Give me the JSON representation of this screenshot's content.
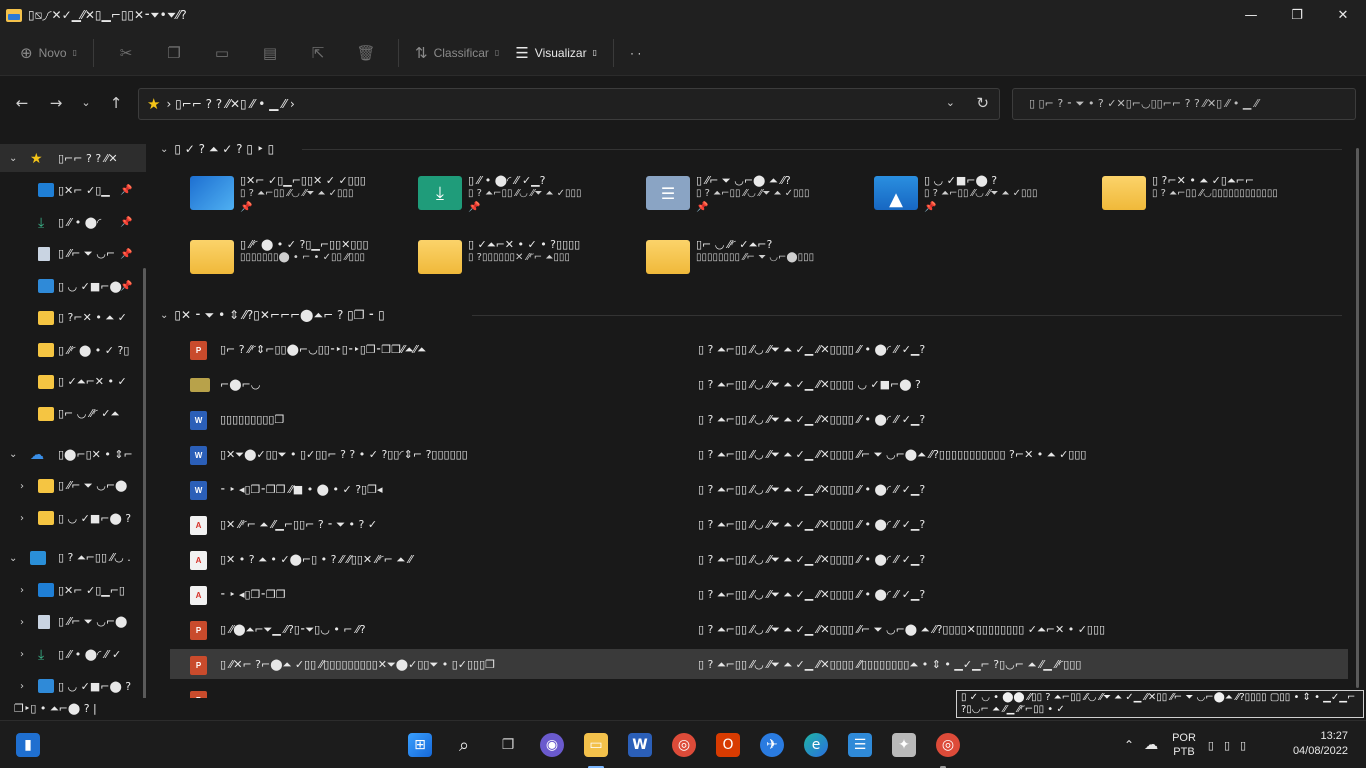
{
  "window": {
    "title": "▯⧅◞◜✕✓▁⁄⁄✕▯▁⌐▯▯✕⁃⏷•⏷⁄⁄?",
    "minimize_glyph": "—",
    "maximize_glyph": "❐",
    "close_glyph": "✕"
  },
  "commandbar": {
    "new_label": "Novo",
    "sort_label": "Classificar",
    "view_label": "Visualizar",
    "more_glyph": "· ·"
  },
  "address": {
    "breadcrumb": "› ▯⌐⌐ ? ? ⁄⁄✕▯ ⁄⁄ • ▁ ⁄⁄ ›",
    "search_placeholder": "▯     ▯⌐ ? ⁃ ⏷ • ? ✓✕▯⌐◡▯▯⌐⌐ ? ? ⁄⁄✕▯ ⁄⁄ • ▁ ⁄⁄"
  },
  "sidebar": {
    "items": [
      {
        "label": "▯⌐⌐ ? ? ⁄⁄✕",
        "icon": "star-icon"
      },
      {
        "label": "▯✕⌐ ✓▯▁",
        "icon": "desktop-icon"
      },
      {
        "label": "▯ ⁄⁄ • ⬤◜",
        "icon": "download-icon"
      },
      {
        "label": "▯ ⁄⁄⌐ ⏷ ◡⌐",
        "icon": "document-icon"
      },
      {
        "label": "▯ ◡ ✓■⌐⬤",
        "icon": "picture-icon"
      },
      {
        "label": "▯ ?⌐✕ • ⏶ ✓",
        "icon": "folder-icon"
      },
      {
        "label": "▯ ⁄⁄◜ ⬤ • ✓ ?▯",
        "icon": "folder-icon"
      },
      {
        "label": "▯ ✓⏶⌐✕ • ✓",
        "icon": "folder-icon"
      },
      {
        "label": "▯⌐ ◡ ⁄⁄◜ ✓⏶",
        "icon": "folder-icon"
      },
      {
        "label": "▯⬤⌐▯✕ • ⇕⌐",
        "icon": "cloud-icon"
      },
      {
        "label": "▯ ⁄⁄⌐ ⏷ ◡⌐⬤",
        "icon": "folder-icon"
      },
      {
        "label": "▯ ◡ ✓■⌐⬤ ?",
        "icon": "folder-icon"
      },
      {
        "label": "▯ ? ⏶⌐▯▯ ⁄⁄◡ .",
        "icon": "pc-icon"
      },
      {
        "label": "▯✕⌐ ✓▯▁⌐▯",
        "icon": "desktop-icon"
      },
      {
        "label": "▯ ⁄⁄⌐ ⏷ ◡⌐⬤",
        "icon": "document-icon"
      },
      {
        "label": "▯ ⁄⁄ • ⬤◜ ⁄⁄ ✓",
        "icon": "download-icon"
      },
      {
        "label": "▯ ◡ ✓■⌐⬤ ?",
        "icon": "picture-icon"
      }
    ]
  },
  "quick_access": {
    "heading": "▯ ✓ ? ⏶ ✓ ? ▯ ‣ ▯",
    "tiles": [
      {
        "name": "▯✕⌐ ✓▯▁⌐▯▯✕ ✓ ✓▯▯▯",
        "sub": "▯ ? ⏶⌐▯▯ ⁄⁄◡ ⁄⁄⏷ ⏶ ✓▯▯▯",
        "pin": "📌"
      },
      {
        "name": "▯ ⁄⁄ • ⬤◜ ⁄⁄ ✓▁?",
        "sub": "▯ ? ⏶⌐▯▯ ⁄⁄◡ ⁄⁄⏷ ⏶ ✓▯▯▯",
        "pin": "📌"
      },
      {
        "name": "▯ ⁄⁄⌐ ⏷ ◡⌐⬤ ⏶ ⁄⁄?",
        "sub": "▯ ? ⏶⌐▯▯ ⁄⁄◡ ⁄⁄⏷ ⏶ ✓▯▯▯",
        "pin": "📌"
      },
      {
        "name": "▯ ◡ ✓■⌐⬤ ?",
        "sub": "▯ ? ⏶⌐▯▯ ⁄⁄◡ ⁄⁄⏷ ⏶ ✓▯▯▯",
        "pin": "📌"
      },
      {
        "name": "▯ ?⌐✕ • ⏶ ✓▯⏶⌐⌐",
        "sub": "▯ ? ⏶⌐▯▯ ⁄⁄◡▯▯▯▯▯▯▯▯▯▯▯▯",
        "pin": ""
      },
      {
        "name": "▯ ⁄⁄◜ ⬤ • ✓ ?▯▁⌐▯▯✕▯▯▯",
        "sub": "▯▯▯▯▯▯▯⬤ • ⌐ • ✓▯▯ ⁄⁄▯▯▯",
        "pin": ""
      },
      {
        "name": "▯ ✓⏶⌐✕ • ✓ • ?▯▯▯▯",
        "sub": "▯ ?▯▯▯▯▯▯✕ ⁄⁄◜⌐ ⏶▯▯▯",
        "pin": ""
      },
      {
        "name": "▯⌐ ◡ ⁄⁄◜ ✓⏶⌐?",
        "sub": "▯▯▯▯▯▯▯▯ ⁄⁄⌐ ⏷ ◡⌐⬤▯▯▯",
        "pin": ""
      }
    ]
  },
  "recent": {
    "heading": "▯✕ ⁃ ⏷ • ⇕ ⁄⁄?▯✕⌐⌐⌐⬤⏶⌐ ? ▯❐ ⁃ ▯",
    "files": [
      {
        "name": "▯⌐ ? ⁄⁄◜⇕⌐▯▯⬤⌐◡▯▯⁃‣▯⁃‣▯❐⁃❐❐⁄⁄⏶⁄⁄⏶",
        "location": "▯ ? ⏶⌐▯▯ ⁄⁄◡ ⁄⁄⏷ ⏶ ✓▁ ⁄⁄✕▯▯▯▯ ⁄⁄ • ⬤◜ ⁄⁄ ✓▁?",
        "type": "ppt"
      },
      {
        "name": "⌐⬤⌐◡",
        "location": "▯ ? ⏶⌐▯▯ ⁄⁄◡ ⁄⁄⏷ ⏶ ✓▁ ⁄⁄✕▯▯▯▯ ◡ ✓■⌐⬤ ?",
        "type": "img"
      },
      {
        "name": "▯▯▯▯▯▯▯▯▯❐",
        "location": "▯ ? ⏶⌐▯▯ ⁄⁄◡ ⁄⁄⏷ ⏶ ✓▁ ⁄⁄✕▯▯▯▯ ⁄⁄ • ⬤◜ ⁄⁄ ✓▁?",
        "type": "doc"
      },
      {
        "name": "▯✕⏷⬤✓▯▯⏷ • ▯✓▯▯⌐ ? ? • ✓ ?▯▯◜⇕⌐ ?▯▯▯▯▯▯",
        "location": "▯ ? ⏶⌐▯▯ ⁄⁄◡ ⁄⁄⏷ ⏶ ✓▁ ⁄⁄✕▯▯▯▯ ⁄⁄⌐ ⏷ ◡⌐⬤⏶ ⁄⁄?▯▯▯▯▯▯▯▯▯▯▯ ?⌐✕ • ⏶ ✓▯▯▯",
        "type": "doc"
      },
      {
        "name": "⁃ ‣ ◂▯❐⁃❐❐ ⁄⁄■ • ⬤ • ✓ ?▯❐◂",
        "location": "▯ ? ⏶⌐▯▯ ⁄⁄◡ ⁄⁄⏷ ⏶ ✓▁ ⁄⁄✕▯▯▯▯ ⁄⁄ • ⬤◜ ⁄⁄ ✓▁?",
        "type": "doc"
      },
      {
        "name": "▯✕ ⁄⁄◜⌐ ⏶ ⁄⁄▁⌐▯▯⌐ ? ⁃ ⏷ • ? ✓",
        "location": "▯ ? ⏶⌐▯▯ ⁄⁄◡ ⁄⁄⏷ ⏶ ✓▁ ⁄⁄✕▯▯▯▯ ⁄⁄ • ⬤◜ ⁄⁄ ✓▁?",
        "type": "pdf"
      },
      {
        "name": "▯✕ • ? ⏶ • ✓⬤⌐▯ • ? ⁄⁄ ⁄⁄▯▯✕ ⁄⁄◜⌐ ⏶ ⁄⁄",
        "location": "▯ ? ⏶⌐▯▯ ⁄⁄◡ ⁄⁄⏷ ⏶ ✓▁ ⁄⁄✕▯▯▯▯ ⁄⁄ • ⬤◜ ⁄⁄ ✓▁?",
        "type": "pdf"
      },
      {
        "name": "⁃ ‣ ◂▯❐⁃❐❐",
        "location": "▯ ? ⏶⌐▯▯ ⁄⁄◡ ⁄⁄⏷ ⏶ ✓▁ ⁄⁄✕▯▯▯▯ ⁄⁄ • ⬤◜ ⁄⁄ ✓▁?",
        "type": "pdf"
      },
      {
        "name": "▯ ⁄⁄⬤⏶⌐⏷▁ ⁄⁄?▯⁃⏷▯◡ • ⌐ ⁄⁄?",
        "location": "▯ ? ⏶⌐▯▯ ⁄⁄◡ ⁄⁄⏷ ⏶ ✓▁ ⁄⁄✕▯▯▯▯ ⁄⁄⌐ ⏷ ◡⌐⬤ ⏶ ⁄⁄?▯▯▯▯✕▯▯▯▯▯▯▯▯ ✓⏶⌐✕ • ✓▯▯▯",
        "type": "ppt"
      },
      {
        "name": "▯ ⁄⁄✕⌐ ?⌐⬤⏶ ✓▯▯ ⁄⁄▯▯▯▯▯▯▯▯▯✕⏷⬤✓▯▯⏷ • ▯✓▯▯▯❐",
        "location": "▯ ? ⏶⌐▯▯ ⁄⁄◡ ⁄⁄⏷ ⏶ ✓▁ ⁄⁄✕▯▯▯▯ ⁄⁄▯▯▯▯▯▯▯▯⏶ • ⇕ • ▁✓▁⌐ ?▯◡⌐ ⏶ ⁄⁄▁ ⁄⁄◜▯▯▯",
        "type": "ppt"
      }
    ]
  },
  "statusbar": {
    "text": "❐‣▯ • ⏶⌐⬤ ?   |"
  },
  "tooltip": {
    "text": "▯ ✓ ◡ • ⬤⬤ ⁄⁄▯▯ ? ⏶⌐▯▯ ⁄⁄◡ ⁄⁄⏷ ⏶ ✓▁ ⁄⁄✕▯▯ ⁄⁄⌐ ⏷ ◡⌐⬤⏶ ⁄⁄?▯▯▯▯ ▢▯▯ • ⇕ • ▁✓▁⌐ ?▯◡⌐ ⏶ ⁄⁄▁ ⁄⁄◜⌐▯▯ • ✓"
  },
  "taskbar": {
    "language": "POR",
    "layout": "PTB",
    "time": "13:27",
    "date": "04/08/2022"
  }
}
